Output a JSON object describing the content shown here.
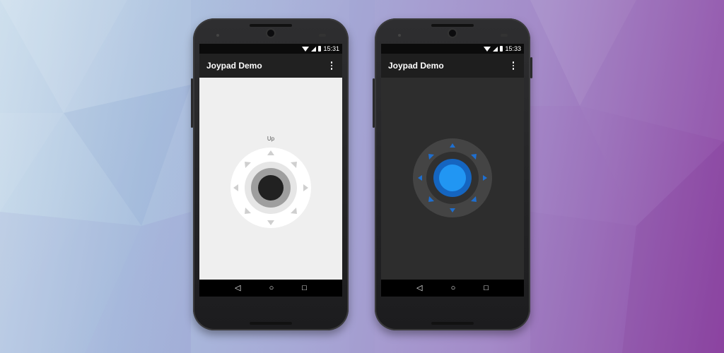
{
  "phones": [
    {
      "theme": "light",
      "status_time": "15:31",
      "app_title": "Joypad Demo",
      "direction_label": "Up",
      "colors": {
        "app_bar": "#212121",
        "background": "#efefef",
        "pad_ring": "#ffffff",
        "pad_inner": "#e6e6e6",
        "knob": "#212121",
        "knob_ring": "#9e9e9e",
        "arrows": "#cfcfcf"
      }
    },
    {
      "theme": "dark",
      "status_time": "15:33",
      "app_title": "Joypad Demo",
      "colors": {
        "app_bar": "#1e1e1e",
        "background": "#2d2d2d",
        "pad_ring": "#444444",
        "pad_inner": "#303030",
        "knob": "#2196f3",
        "knob_ring": "#1565c0",
        "arrows": "#1e6fd0"
      }
    }
  ],
  "icons": {
    "status": [
      "wifi-icon",
      "signal-icon",
      "battery-icon"
    ],
    "nav": [
      "back-icon",
      "home-icon",
      "recents-icon"
    ],
    "overflow": "more-vert-icon"
  },
  "nav_glyphs": {
    "back": "◁",
    "home": "○",
    "recents": "□"
  }
}
